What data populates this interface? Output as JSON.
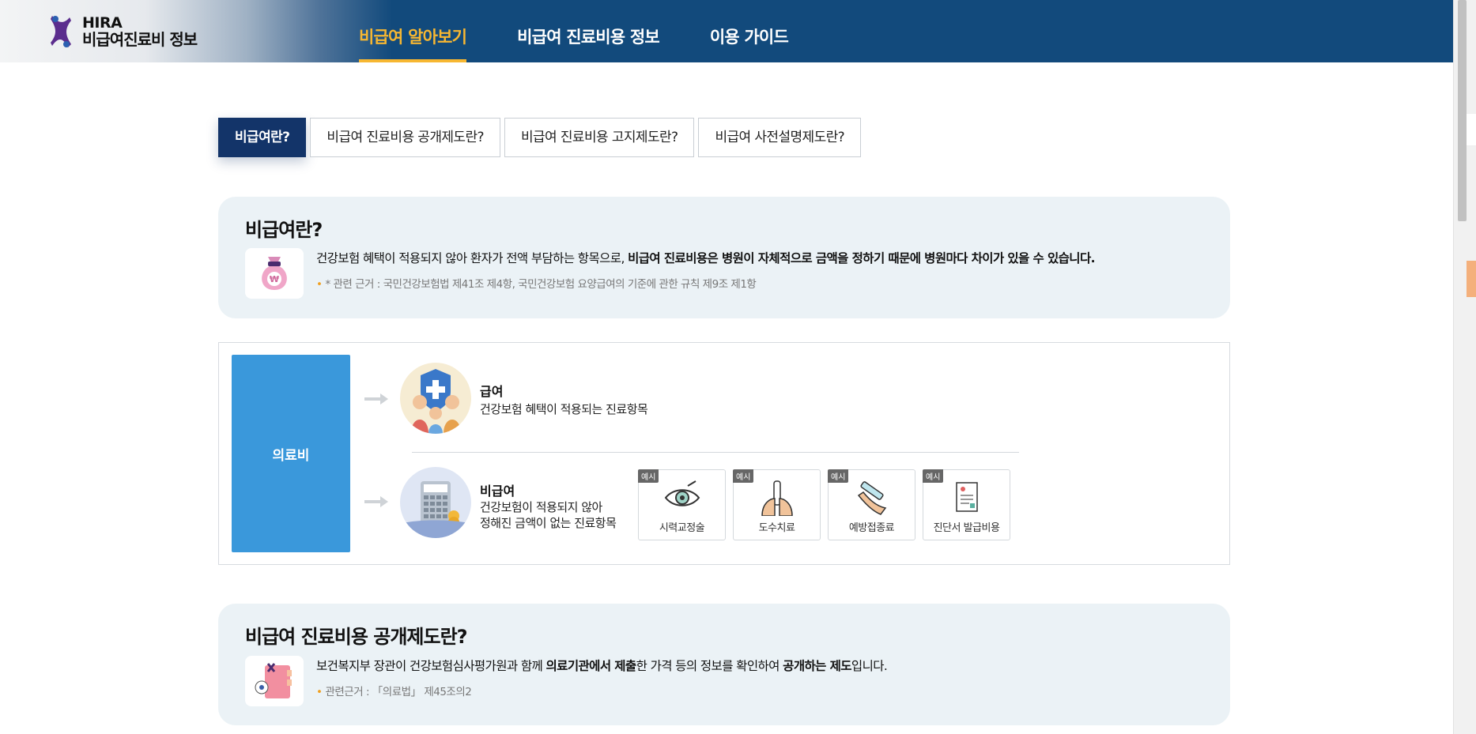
{
  "header": {
    "logo_title": "HIRA",
    "logo_subtitle": "비급여진료비 정보",
    "nav": [
      "비급여 알아보기",
      "비급여 진료비용 정보",
      "이용 가이드"
    ]
  },
  "tabs": [
    "비급여란?",
    "비급여 진료비용 공개제도란?",
    "비급여 진료비용 고지제도란?",
    "비급여 사전설명제도란?"
  ],
  "section1": {
    "title": "비급여란?",
    "desc_pre": "건강보험 혜택이 적용되지 않아 환자가 전액 부담하는 항목으로, ",
    "desc_bold": "비급여 진료비용은 병원이 자체적으로 금액을 정하기 때문에 병원마다 차이가 있을 수 있습니다.",
    "ref": "* 관련 근거 : 국민건강보험법 제41조 제4항, 국민건강보험 요양급여의 기준에 관한 규칙 제9조 제1항"
  },
  "diagram": {
    "root": "의료비",
    "covered_title": "급여",
    "covered_desc": "건강보험 혜택이 적용되는 진료항목",
    "noncovered_title": "비급여",
    "noncovered_desc_1": "건강보험이 적용되지 않아",
    "noncovered_desc_2": "정해진 금액이 없는 진료항목",
    "example_badge": "예시",
    "examples": [
      "시력교정술",
      "도수치료",
      "예방접종료",
      "진단서 발급비용"
    ]
  },
  "section2": {
    "title": "비급여 진료비용 공개제도란?",
    "desc_a": "보건복지부 장관이 건강보험심사평가원과 함께 ",
    "desc_b": "의료기관에서 제출",
    "desc_c": "한 가격 등의 정보를 확인하여 ",
    "desc_d": "공개하는 제도",
    "desc_e": "입니다.",
    "ref": "관련근거 : 「의료법」 제45조의2"
  },
  "colors": {
    "header_bg": "#124a7c",
    "active_nav": "#f7b731",
    "active_tab": "#133469",
    "medical_box": "#3a98db",
    "info_bg": "#ebf2f6"
  }
}
